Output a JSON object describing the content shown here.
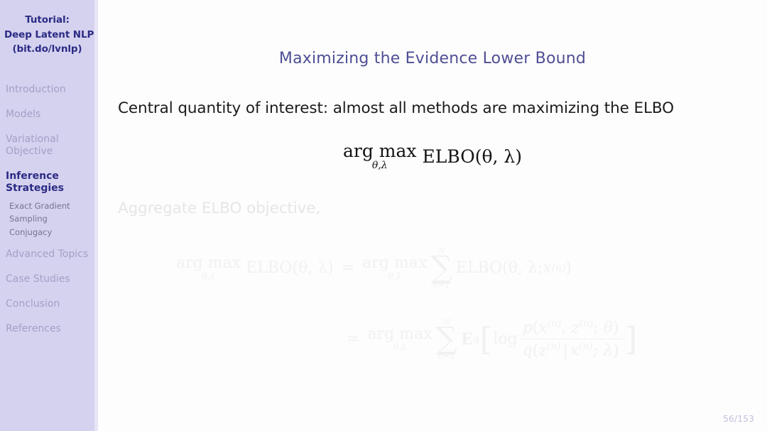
{
  "sidebar": {
    "title_lines": [
      "Tutorial:",
      "Deep Latent NLP",
      "(bit.do/lvnlp)"
    ],
    "sections": [
      {
        "lines": [
          "Introduction"
        ],
        "active": false
      },
      {
        "lines": [
          "Models"
        ],
        "active": false
      },
      {
        "lines": [
          "Variational",
          "Objective"
        ],
        "active": false
      },
      {
        "lines": [
          "Inference",
          "Strategies"
        ],
        "active": true
      }
    ],
    "subsections": [
      "Exact Gradient",
      "Sampling",
      "Conjugacy"
    ],
    "sections_after": [
      {
        "lines": [
          "Advanced Topics"
        ],
        "active": false
      },
      {
        "lines": [
          "Case Studies"
        ],
        "active": false
      },
      {
        "lines": [
          "Conclusion"
        ],
        "active": false
      },
      {
        "lines": [
          "References"
        ],
        "active": false
      }
    ],
    "colors": {
      "background": "#d5d2f0",
      "edge": "#e7e5f7",
      "active_text": "#2b2b84",
      "inactive_text": "#a3a0c6",
      "subsection_text": "#77748f"
    }
  },
  "content": {
    "frame_title": "Maximizing the Evidence Lower Bound",
    "lead_text": "Central quantity of interest: almost all methods are maximizing the ELBO",
    "faded_text": "Aggregate ELBO objective,",
    "page_number": "56/153",
    "colors": {
      "background": "#fdfdfd",
      "title": "#4e4e94",
      "body_text": "#1b1b1b",
      "faded_text": "#e6e6e6",
      "faded_math": "#f1f1f1",
      "page_number": "#c3c1dd"
    }
  },
  "equations": {
    "main": {
      "argmax": "arg max",
      "argmax_sub": "θ,λ",
      "body": "ELBO(θ, λ)"
    },
    "faded_line1": {
      "argmax": "arg max",
      "argmax_sub": "θ,λ",
      "lhs": "ELBO(θ, λ)",
      "relation": "=",
      "argmax2": "arg max",
      "argmax2_sub": "θ,λ",
      "sum_top": "N",
      "sum_glyph": "∑",
      "sum_bot": "n=1",
      "rhs_prefix": "ELBO(θ, λ; ",
      "rhs_var": "x",
      "rhs_sup": "(n)",
      "rhs_suffix": ")"
    },
    "faded_line2": {
      "relation": "=",
      "argmax": "arg max",
      "argmax_sub": "θ,λ",
      "sum_top": "N",
      "sum_glyph": "∑",
      "sum_bot": "n=1",
      "expectation": "E",
      "expectation_sub": "q",
      "bracket_open": "[",
      "log": "log",
      "numerator": "p(x(n), z(n); θ)",
      "denominator": "q(z(n) | x(n); λ)",
      "bracket_close": "]"
    }
  }
}
